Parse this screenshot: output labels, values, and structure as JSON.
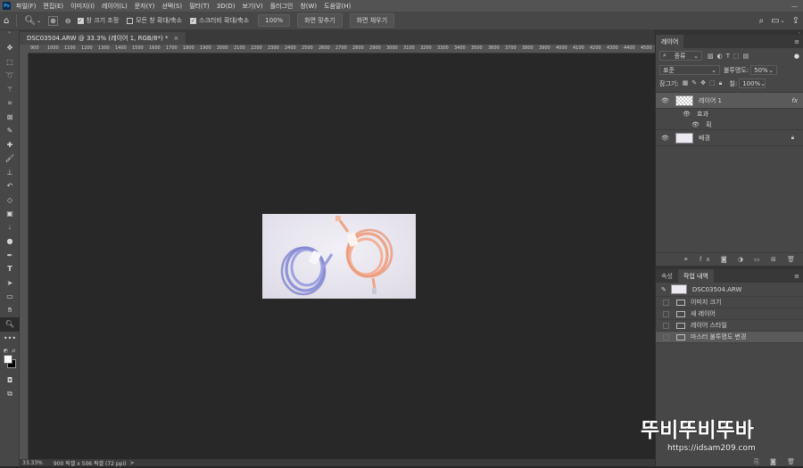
{
  "app": {
    "logo": "Ps"
  },
  "menu": [
    "파일(F)",
    "편집(E)",
    "이미지(I)",
    "레이어(L)",
    "문자(Y)",
    "선택(S)",
    "필터(T)",
    "3D(D)",
    "보기(V)",
    "플러그인",
    "창(W)",
    "도움말(H)"
  ],
  "options": {
    "resize_windows": "창 크기 조정",
    "zoom_all": "모든 창 확대/축소",
    "scrubby_zoom": "스크러비 확대/축소",
    "zoom_value": "100%",
    "fit_screen": "화면 맞추기",
    "fill_screen": "화면 채우기"
  },
  "document": {
    "tab_title": "DSC03504.ARW @ 33.3% (레이어 1, RGB/8*) *",
    "close": "×",
    "ruler_ticks": [
      "900",
      "1000",
      "1100",
      "1200",
      "1300",
      "1400",
      "1500",
      "1600",
      "1700",
      "1800",
      "1900",
      "2000",
      "2100",
      "2200",
      "2300",
      "2400",
      "2500",
      "2600",
      "2700",
      "2800",
      "2900",
      "3000",
      "3100",
      "3200",
      "3300",
      "3400",
      "3500",
      "3600",
      "3700",
      "3800",
      "3900",
      "4000",
      "4100",
      "4200",
      "4300",
      "4400",
      "4500"
    ]
  },
  "status": {
    "zoom": "33.33%",
    "info": "900 픽셀 x 506 픽셀 (72 ppi)",
    "arrow": ">"
  },
  "layers_panel": {
    "tab": "레이어",
    "filter_kind": "종류",
    "blend_mode": "표준",
    "opacity_label": "불투명도:",
    "opacity_value": "50%",
    "lock_label": "잠그기:",
    "fill_label": "칠:",
    "fill_value": "100%",
    "layers": [
      {
        "name": "레이어 1",
        "fx": "fx"
      },
      {
        "name": "효과"
      },
      {
        "name": "획"
      },
      {
        "name": "배경"
      }
    ]
  },
  "history_panel": {
    "tab_properties": "속성",
    "tab_history": "작업 내역",
    "snapshot": "DSC03504.ARW",
    "items": [
      "이미지 크기",
      "새 레이어",
      "레이어 스타일",
      "마스터 불투명도 변경"
    ]
  },
  "watermark": {
    "text": "뚜비뚜비뚜바",
    "url": "https://idsam209.com"
  }
}
